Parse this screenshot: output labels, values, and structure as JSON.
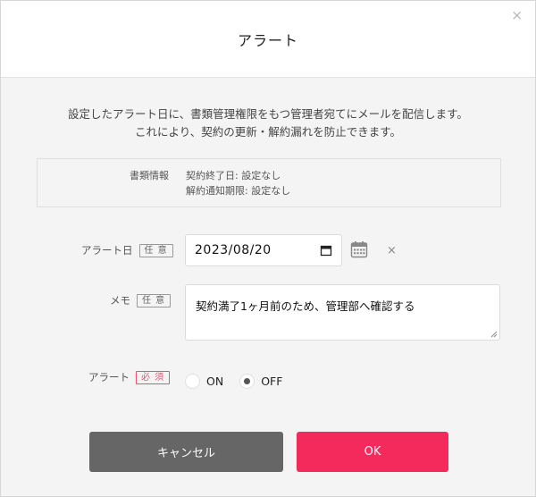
{
  "dialog": {
    "title": "アラート",
    "close_glyph": "×"
  },
  "description": {
    "line1": "設定したアラート日に、書類管理権限をもつ管理者宛てにメールを配信します。",
    "line2": "これにより、契約の更新・解約漏れを防止できます。"
  },
  "document_info": {
    "label": "書類情報",
    "lines": [
      "契約終了日: 設定なし",
      "解約通知期限: 設定なし"
    ]
  },
  "alert_date": {
    "label": "アラート日",
    "badge": "任 意",
    "value": "2023/08/20",
    "clear_glyph": "×"
  },
  "memo": {
    "label": "メモ",
    "badge": "任 意",
    "value": "契約満了1ヶ月前のため、管理部へ確認する"
  },
  "alert_toggle": {
    "label": "アラート",
    "badge": "必 須",
    "options": [
      {
        "label": "ON",
        "selected": false
      },
      {
        "label": "OFF",
        "selected": true
      }
    ]
  },
  "buttons": {
    "cancel": "キャンセル",
    "ok": "OK"
  },
  "colors": {
    "primary": "#f52a5c",
    "cancel": "#666666",
    "required": "#f0506e",
    "background": "#f4f4f4"
  },
  "icons": {
    "close": "close-icon",
    "calendar": "calendar-icon",
    "clear": "clear-icon"
  }
}
